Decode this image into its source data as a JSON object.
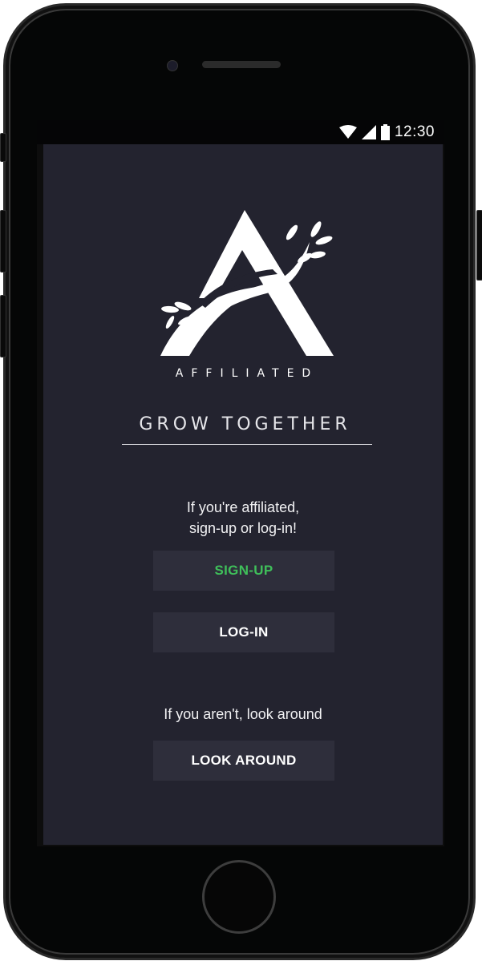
{
  "status_bar": {
    "time": "12:30",
    "icons": [
      "wifi-icon",
      "signal-icon",
      "battery-icon"
    ]
  },
  "brand": {
    "name": "AFFILIATED",
    "tagline": "GROW TOGETHER"
  },
  "affiliated_prompt": {
    "line1": "If you're affiliated,",
    "line2": "sign-up or log-in!"
  },
  "buttons": {
    "signup_label": "SIGN-UP",
    "login_label": "LOG-IN",
    "look_around_label": "LOOK AROUND"
  },
  "guest_prompt": "If you aren't, look around",
  "colors": {
    "background": "#23232f",
    "button": "#2e2e3b",
    "accent_green": "#3fbf5a",
    "text": "#ffffff"
  }
}
